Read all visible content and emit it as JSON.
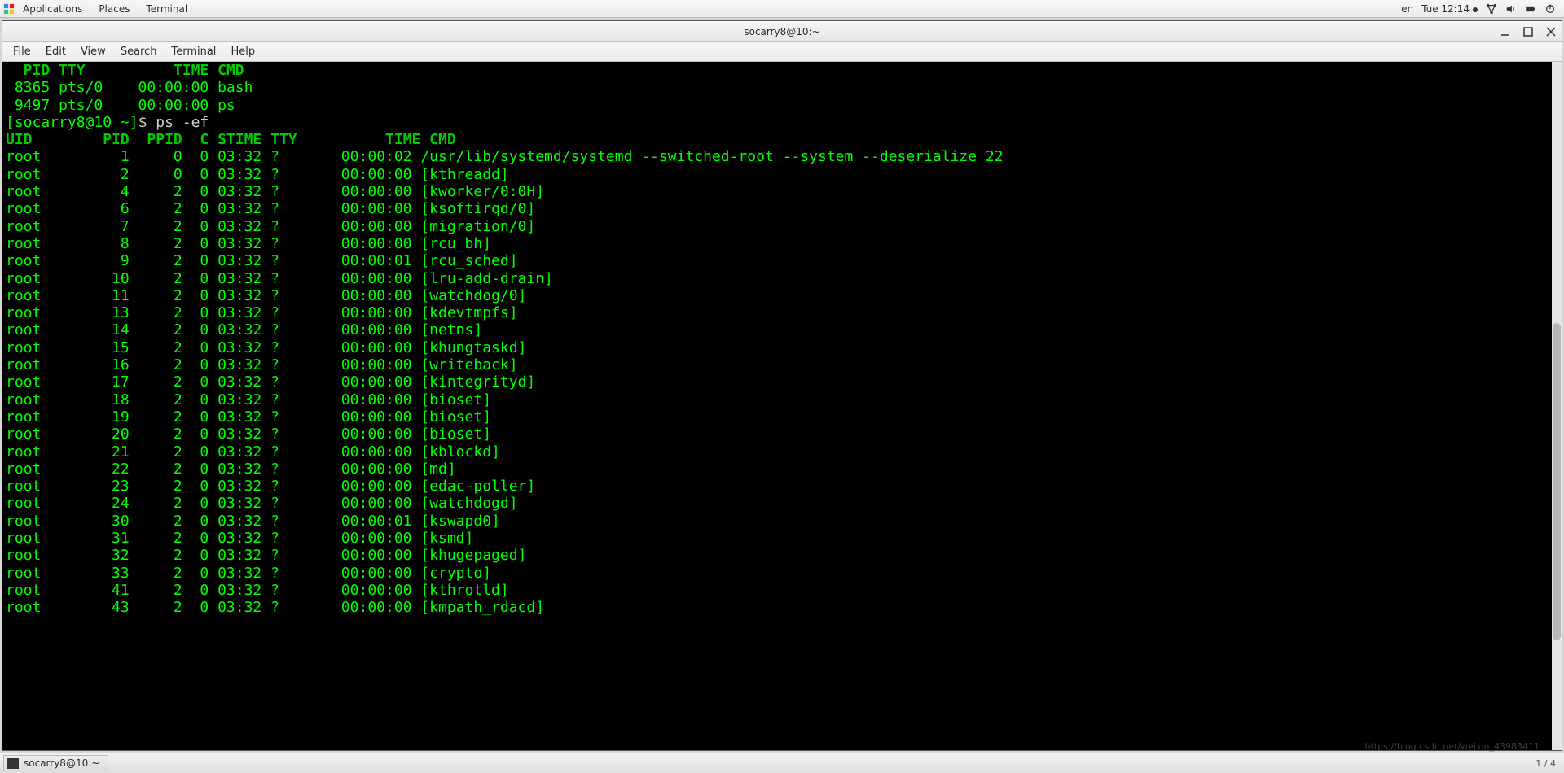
{
  "panel": {
    "apps": "Applications",
    "places": "Places",
    "terminal": "Terminal",
    "lang": "en",
    "clock": "Tue 12:14"
  },
  "window": {
    "title": "socarry8@10:~",
    "menus": [
      "File",
      "Edit",
      "View",
      "Search",
      "Terminal",
      "Help"
    ]
  },
  "term": {
    "ps_header": "  PID TTY          TIME CMD",
    "ps_lines": [
      " 8365 pts/0    00:00:00 bash",
      " 9497 pts/0    00:00:00 ps"
    ],
    "prompt_user": "[socarry8@10 ~]",
    "prompt_dollar": "$ ",
    "prompt_cmd": "ps -ef",
    "ef_header": "UID        PID  PPID  C STIME TTY          TIME CMD",
    "rows": [
      {
        "uid": "root",
        "pid": "1",
        "ppid": "0",
        "c": "0",
        "stime": "03:32",
        "tty": "?",
        "time": "00:00:02",
        "cmd": "/usr/lib/systemd/systemd --switched-root --system --deserialize 22"
      },
      {
        "uid": "root",
        "pid": "2",
        "ppid": "0",
        "c": "0",
        "stime": "03:32",
        "tty": "?",
        "time": "00:00:00",
        "cmd": "[kthreadd]"
      },
      {
        "uid": "root",
        "pid": "4",
        "ppid": "2",
        "c": "0",
        "stime": "03:32",
        "tty": "?",
        "time": "00:00:00",
        "cmd": "[kworker/0:0H]"
      },
      {
        "uid": "root",
        "pid": "6",
        "ppid": "2",
        "c": "0",
        "stime": "03:32",
        "tty": "?",
        "time": "00:00:00",
        "cmd": "[ksoftirqd/0]"
      },
      {
        "uid": "root",
        "pid": "7",
        "ppid": "2",
        "c": "0",
        "stime": "03:32",
        "tty": "?",
        "time": "00:00:00",
        "cmd": "[migration/0]"
      },
      {
        "uid": "root",
        "pid": "8",
        "ppid": "2",
        "c": "0",
        "stime": "03:32",
        "tty": "?",
        "time": "00:00:00",
        "cmd": "[rcu_bh]"
      },
      {
        "uid": "root",
        "pid": "9",
        "ppid": "2",
        "c": "0",
        "stime": "03:32",
        "tty": "?",
        "time": "00:00:01",
        "cmd": "[rcu_sched]"
      },
      {
        "uid": "root",
        "pid": "10",
        "ppid": "2",
        "c": "0",
        "stime": "03:32",
        "tty": "?",
        "time": "00:00:00",
        "cmd": "[lru-add-drain]"
      },
      {
        "uid": "root",
        "pid": "11",
        "ppid": "2",
        "c": "0",
        "stime": "03:32",
        "tty": "?",
        "time": "00:00:00",
        "cmd": "[watchdog/0]"
      },
      {
        "uid": "root",
        "pid": "13",
        "ppid": "2",
        "c": "0",
        "stime": "03:32",
        "tty": "?",
        "time": "00:00:00",
        "cmd": "[kdevtmpfs]"
      },
      {
        "uid": "root",
        "pid": "14",
        "ppid": "2",
        "c": "0",
        "stime": "03:32",
        "tty": "?",
        "time": "00:00:00",
        "cmd": "[netns]"
      },
      {
        "uid": "root",
        "pid": "15",
        "ppid": "2",
        "c": "0",
        "stime": "03:32",
        "tty": "?",
        "time": "00:00:00",
        "cmd": "[khungtaskd]"
      },
      {
        "uid": "root",
        "pid": "16",
        "ppid": "2",
        "c": "0",
        "stime": "03:32",
        "tty": "?",
        "time": "00:00:00",
        "cmd": "[writeback]"
      },
      {
        "uid": "root",
        "pid": "17",
        "ppid": "2",
        "c": "0",
        "stime": "03:32",
        "tty": "?",
        "time": "00:00:00",
        "cmd": "[kintegrityd]"
      },
      {
        "uid": "root",
        "pid": "18",
        "ppid": "2",
        "c": "0",
        "stime": "03:32",
        "tty": "?",
        "time": "00:00:00",
        "cmd": "[bioset]"
      },
      {
        "uid": "root",
        "pid": "19",
        "ppid": "2",
        "c": "0",
        "stime": "03:32",
        "tty": "?",
        "time": "00:00:00",
        "cmd": "[bioset]"
      },
      {
        "uid": "root",
        "pid": "20",
        "ppid": "2",
        "c": "0",
        "stime": "03:32",
        "tty": "?",
        "time": "00:00:00",
        "cmd": "[bioset]"
      },
      {
        "uid": "root",
        "pid": "21",
        "ppid": "2",
        "c": "0",
        "stime": "03:32",
        "tty": "?",
        "time": "00:00:00",
        "cmd": "[kblockd]"
      },
      {
        "uid": "root",
        "pid": "22",
        "ppid": "2",
        "c": "0",
        "stime": "03:32",
        "tty": "?",
        "time": "00:00:00",
        "cmd": "[md]"
      },
      {
        "uid": "root",
        "pid": "23",
        "ppid": "2",
        "c": "0",
        "stime": "03:32",
        "tty": "?",
        "time": "00:00:00",
        "cmd": "[edac-poller]"
      },
      {
        "uid": "root",
        "pid": "24",
        "ppid": "2",
        "c": "0",
        "stime": "03:32",
        "tty": "?",
        "time": "00:00:00",
        "cmd": "[watchdogd]"
      },
      {
        "uid": "root",
        "pid": "30",
        "ppid": "2",
        "c": "0",
        "stime": "03:32",
        "tty": "?",
        "time": "00:00:01",
        "cmd": "[kswapd0]"
      },
      {
        "uid": "root",
        "pid": "31",
        "ppid": "2",
        "c": "0",
        "stime": "03:32",
        "tty": "?",
        "time": "00:00:00",
        "cmd": "[ksmd]"
      },
      {
        "uid": "root",
        "pid": "32",
        "ppid": "2",
        "c": "0",
        "stime": "03:32",
        "tty": "?",
        "time": "00:00:00",
        "cmd": "[khugepaged]"
      },
      {
        "uid": "root",
        "pid": "33",
        "ppid": "2",
        "c": "0",
        "stime": "03:32",
        "tty": "?",
        "time": "00:00:00",
        "cmd": "[crypto]"
      },
      {
        "uid": "root",
        "pid": "41",
        "ppid": "2",
        "c": "0",
        "stime": "03:32",
        "tty": "?",
        "time": "00:00:00",
        "cmd": "[kthrotld]"
      },
      {
        "uid": "root",
        "pid": "43",
        "ppid": "2",
        "c": "0",
        "stime": "03:32",
        "tty": "?",
        "time": "00:00:00",
        "cmd": "[kmpath_rdacd]"
      }
    ]
  },
  "taskbar": {
    "task_label": "socarry8@10:~",
    "workspace": "1 / 4"
  },
  "watermark": "https://blog.csdn.net/weixin_43983411"
}
